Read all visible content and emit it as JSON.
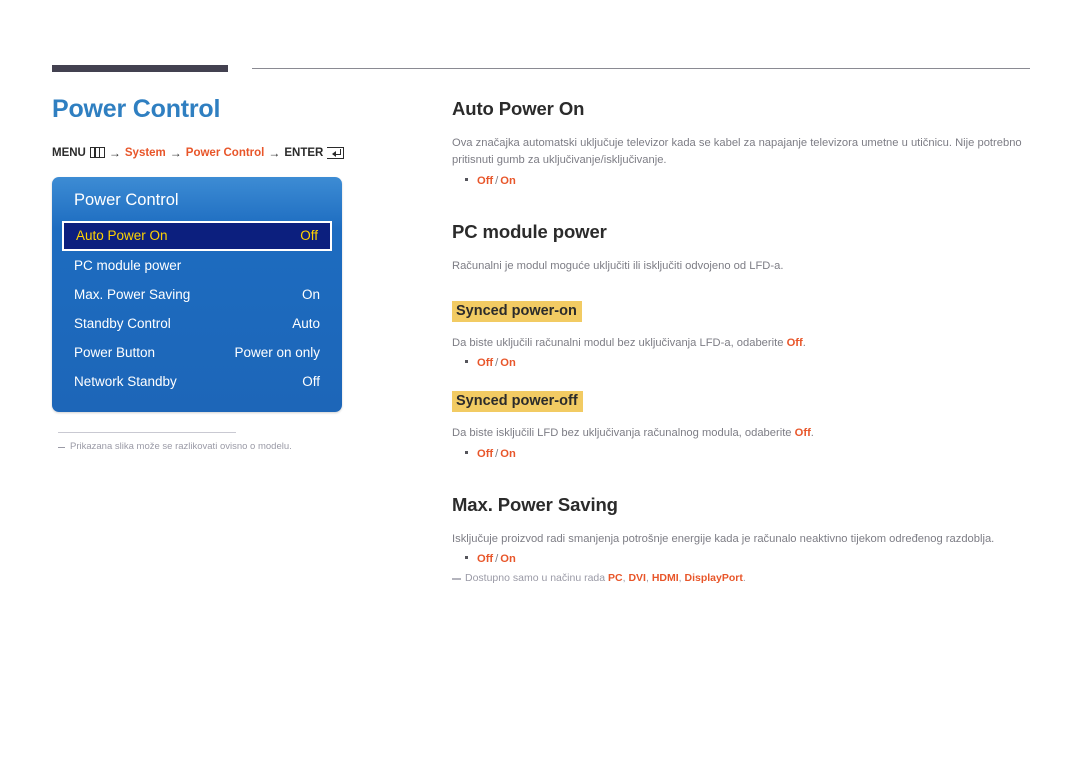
{
  "page": {
    "title": "Power Control",
    "breadcrumb": {
      "menu_label": "MENU",
      "menu_icon": "menu-grid-icon",
      "arrow": "→",
      "step1": "System",
      "step2": "Power Control",
      "enter_label": "ENTER",
      "enter_icon": "enter-key-icon"
    },
    "accent_blue": "#2f7fc1",
    "accent_orange": "#e8562a",
    "highlight_yellow": "#f2cb63"
  },
  "osd": {
    "title": "Power Control",
    "rows": [
      {
        "label": "Auto Power On",
        "value": "Off",
        "selected": true
      },
      {
        "label": "PC module power",
        "value": "",
        "selected": false
      },
      {
        "label": "Max. Power Saving",
        "value": "On",
        "selected": false
      },
      {
        "label": "Standby Control",
        "value": "Auto",
        "selected": false
      },
      {
        "label": "Power Button",
        "value": "Power on only",
        "selected": false
      },
      {
        "label": "Network Standby",
        "value": "Off",
        "selected": false
      }
    ],
    "image_note": "Prikazana slika može se razlikovati ovisno o modelu."
  },
  "sections": [
    {
      "id": "auto-power-on",
      "heading": "Auto Power On",
      "body": "Ova značajka automatski uključuje televizor kada se kabel za napajanje televizora umetne u utičnicu. Nije potrebno pritisnuti gumb za uključivanje/isključivanje.",
      "option_off": "Off",
      "option_sep": "/",
      "option_on": "On"
    },
    {
      "id": "pc-module-power",
      "heading": "PC module power",
      "body": "Računalni je modul moguće uključiti ili isključiti odvojeno od LFD-a.",
      "sub1": {
        "heading": "Synced power-on",
        "body_before": "Da biste uključili računalni modul bez uključivanja LFD-a, odaberite ",
        "body_orange": "Off",
        "body_after": ".",
        "option_off": "Off",
        "option_sep": "/",
        "option_on": "On"
      },
      "sub2": {
        "heading": "Synced power-off",
        "body_before": "Da biste isključili LFD bez uključivanja računalnog modula, odaberite ",
        "body_orange": "Off",
        "body_after": ".",
        "option_off": "Off",
        "option_sep": "/",
        "option_on": "On"
      }
    },
    {
      "id": "max-power-saving",
      "heading": "Max. Power Saving",
      "body": "Isključuje proizvod radi smanjenja potrošnje energije kada je računalo neaktivno tijekom određenog razdoblja.",
      "option_off": "Off",
      "option_sep": "/",
      "option_on": "On",
      "note_before": "Dostupno samo u načinu rada ",
      "note_modes": [
        "PC",
        "DVI",
        "HDMI",
        "DisplayPort"
      ],
      "note_sep": ", ",
      "note_after": "."
    }
  ]
}
